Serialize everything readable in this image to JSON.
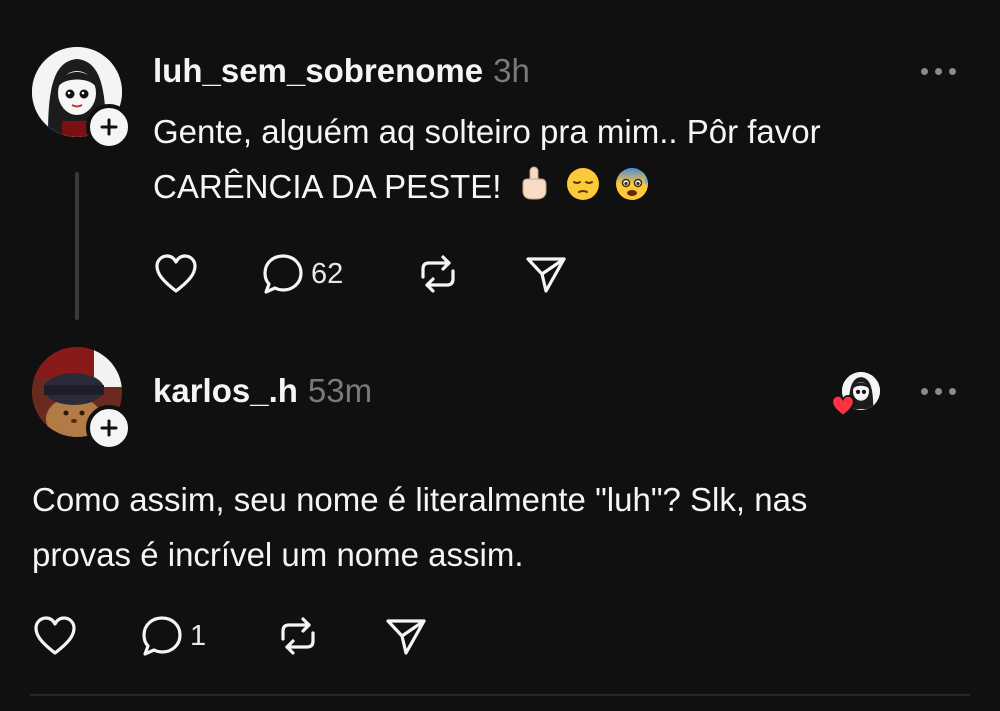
{
  "post": {
    "username": "luh_sem_sobrenome",
    "time": "3h",
    "text_line1": "Gente, alguém aq solteiro pra mim.. Pôr favor",
    "text_line2": "CARÊNCIA DA PESTE!",
    "emojis": [
      "point-up-icon",
      "pensive-face-icon",
      "anxious-face-icon"
    ],
    "replies_count": "62"
  },
  "reply": {
    "username": "karlos_.h",
    "time": "53m",
    "text_line1": "Como assim, seu nome é literalmente \"luh\"? Slk, nas",
    "text_line2": "provas é incrível um nome assim.",
    "replies_count": "1",
    "liked_by_author": true
  },
  "colors": {
    "background": "#101010",
    "text": "#f3f5f7",
    "muted": "#7a7a7a",
    "like_heart": "#ff3040"
  }
}
